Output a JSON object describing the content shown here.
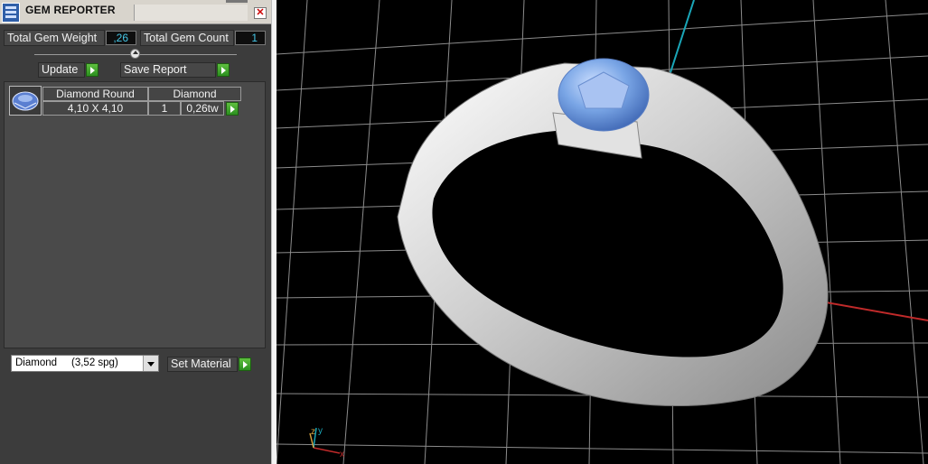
{
  "window": {
    "title": "GEM REPORTER"
  },
  "summary": {
    "weight_label": "Total Gem Weight",
    "weight_value": ",26",
    "count_label": "Total Gem Count",
    "count_value": "1"
  },
  "toolbar": {
    "update_label": "Update",
    "save_label": "Save Report"
  },
  "gem_list": {
    "rows": [
      {
        "shape": "Diamond Round",
        "size": "4,10 X 4,10",
        "material": "Diamond",
        "count": "1",
        "weight": "0,26tw"
      }
    ]
  },
  "material_select": {
    "selected": "Diamond     (3,52 spg)"
  },
  "set_material_label": "Set Material",
  "colors": {
    "gem": "#7aa6e6",
    "axis_y": "#1aa6b8",
    "axis_x": "#c02a2a",
    "grid": "#9a9a9a",
    "metal": "#d9d9d9"
  },
  "icons": {
    "app": "gem-reporter-app-icon",
    "close": "close-icon",
    "go": "play-arrow-icon",
    "slider": "slider-knob-icon",
    "dropdown": "chevron-down-icon",
    "gem": "round-gem-icon"
  }
}
